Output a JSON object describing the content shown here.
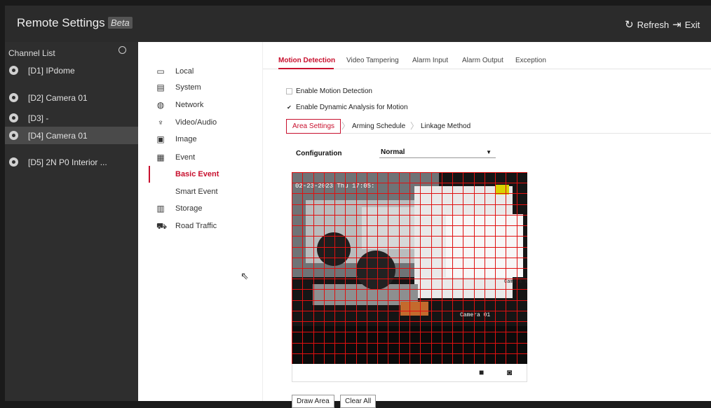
{
  "app": {
    "title": "Remote Settings",
    "beta_badge": "Beta",
    "refresh_label": "Refresh",
    "exit_label": "Exit"
  },
  "channel_list": {
    "header": "Channel List",
    "items": [
      {
        "label": "[D1] IPdome",
        "selected": false
      },
      {
        "label": "[D2] Camera 01",
        "selected": false
      },
      {
        "label": "[D3] -",
        "selected": false
      },
      {
        "label": "[D4] Camera 01",
        "selected": true
      },
      {
        "label": "[D5] 2N P0 Interior ...",
        "selected": false
      }
    ]
  },
  "nav": {
    "items": [
      {
        "label": "Local",
        "icon": "monitor-icon"
      },
      {
        "label": "System",
        "icon": "system-icon"
      },
      {
        "label": "Network",
        "icon": "globe-icon"
      },
      {
        "label": "Video/Audio",
        "icon": "microphone-icon"
      },
      {
        "label": "Image",
        "icon": "image-icon"
      },
      {
        "label": "Event",
        "icon": "calendar-icon"
      },
      {
        "label": "Basic Event",
        "active": true
      },
      {
        "label": "Smart Event"
      },
      {
        "label": "Storage",
        "icon": "save-icon"
      },
      {
        "label": "Road Traffic",
        "icon": "vehicle-search-icon"
      }
    ]
  },
  "tabs": [
    {
      "label": "Motion Detection",
      "active": true
    },
    {
      "label": "Video Tampering"
    },
    {
      "label": "Alarm Input"
    },
    {
      "label": "Alarm Output"
    },
    {
      "label": "Exception"
    }
  ],
  "options": {
    "enable_motion_detection": {
      "label": "Enable Motion Detection",
      "checked": false
    },
    "enable_dynamic_analysis": {
      "label": "Enable Dynamic Analysis for Motion",
      "checked": true
    }
  },
  "subtabs": [
    {
      "label": "Area Settings",
      "active": true
    },
    {
      "label": "Arming Schedule"
    },
    {
      "label": "Linkage Method"
    }
  ],
  "configuration": {
    "label": "Configuration",
    "value": "Normal"
  },
  "video": {
    "timestamp": "02-23-2023 Thu 17:05:",
    "overlay_right": "Camera 01",
    "overlay_bottom": "Camera 01",
    "grid_color": "#e01010"
  },
  "buttons": {
    "draw_area": "Draw Area",
    "clear_all": "Clear All"
  },
  "colors": {
    "accent": "#c8102e",
    "sidebar_bg": "#2e2e2e",
    "titlebar_bg": "#2b2b2b"
  }
}
